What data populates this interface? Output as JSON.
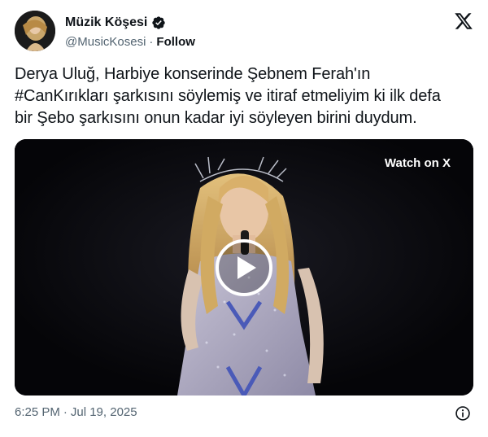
{
  "author": {
    "display_name": "Müzik Köşesi",
    "handle": "@MusicKosesi",
    "separator": "·",
    "follow_label": "Follow",
    "avatar_icon": "profile-photo",
    "verified_icon": "verified-badge-icon"
  },
  "header": {
    "platform_icon": "x-logo-icon"
  },
  "tweet": {
    "lines": [
      "Derya Uluğ, Harbiye konserinde Şebnem Ferah'ın",
      "#CanKırıkları şarkısını söylemiş ve itiraf etmeliyim ki ilk defa",
      "bir Şebo şarkısını onun kadar iyi söyleyen birini duydum."
    ]
  },
  "media": {
    "type": "video",
    "watch_label": "Watch on X",
    "play_icon": "play-icon"
  },
  "footer": {
    "time": "6:25 PM",
    "separator": "·",
    "date": "Jul 19, 2025",
    "info_icon": "info-icon"
  },
  "colors": {
    "text_primary": "#0f1419",
    "text_secondary": "#536471",
    "verified_badge": "#1d9bf0",
    "media_background": "#06060a"
  }
}
